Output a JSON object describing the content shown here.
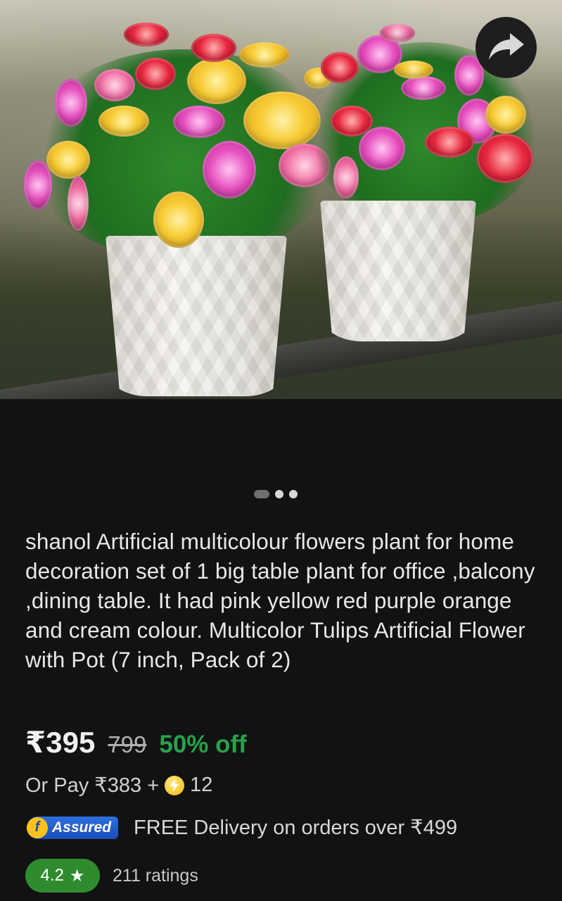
{
  "product": {
    "title": "shanol Artificial multicolour flowers plant for home decoration set of 1 big table plant for office ,balcony ,dining table. It had pink yellow red purple orange and cream colour. Multicolor Tulips Artificial Flower  with Pot (7 inch, Pack of 2)",
    "carousel": {
      "total_images": 3,
      "active_index": 0
    }
  },
  "pricing": {
    "price": "₹395",
    "mrp": "799",
    "discount": "50% off",
    "pay_with_prefix": "Or Pay ₹383 +",
    "supercoins": "12"
  },
  "badges": {
    "assured_label": "Assured",
    "delivery_text": "FREE Delivery on orders over ₹499"
  },
  "rating": {
    "value": "4.2",
    "star": "★",
    "count_text": "211 ratings"
  },
  "icons": {
    "share": "share-arrow-icon",
    "supercoin": "lightning-coin-icon"
  },
  "colors": {
    "background": "#121212",
    "discount_green": "#27a24a",
    "rating_green": "#2e8b2e",
    "assured_blue": "#1a4fb6"
  }
}
